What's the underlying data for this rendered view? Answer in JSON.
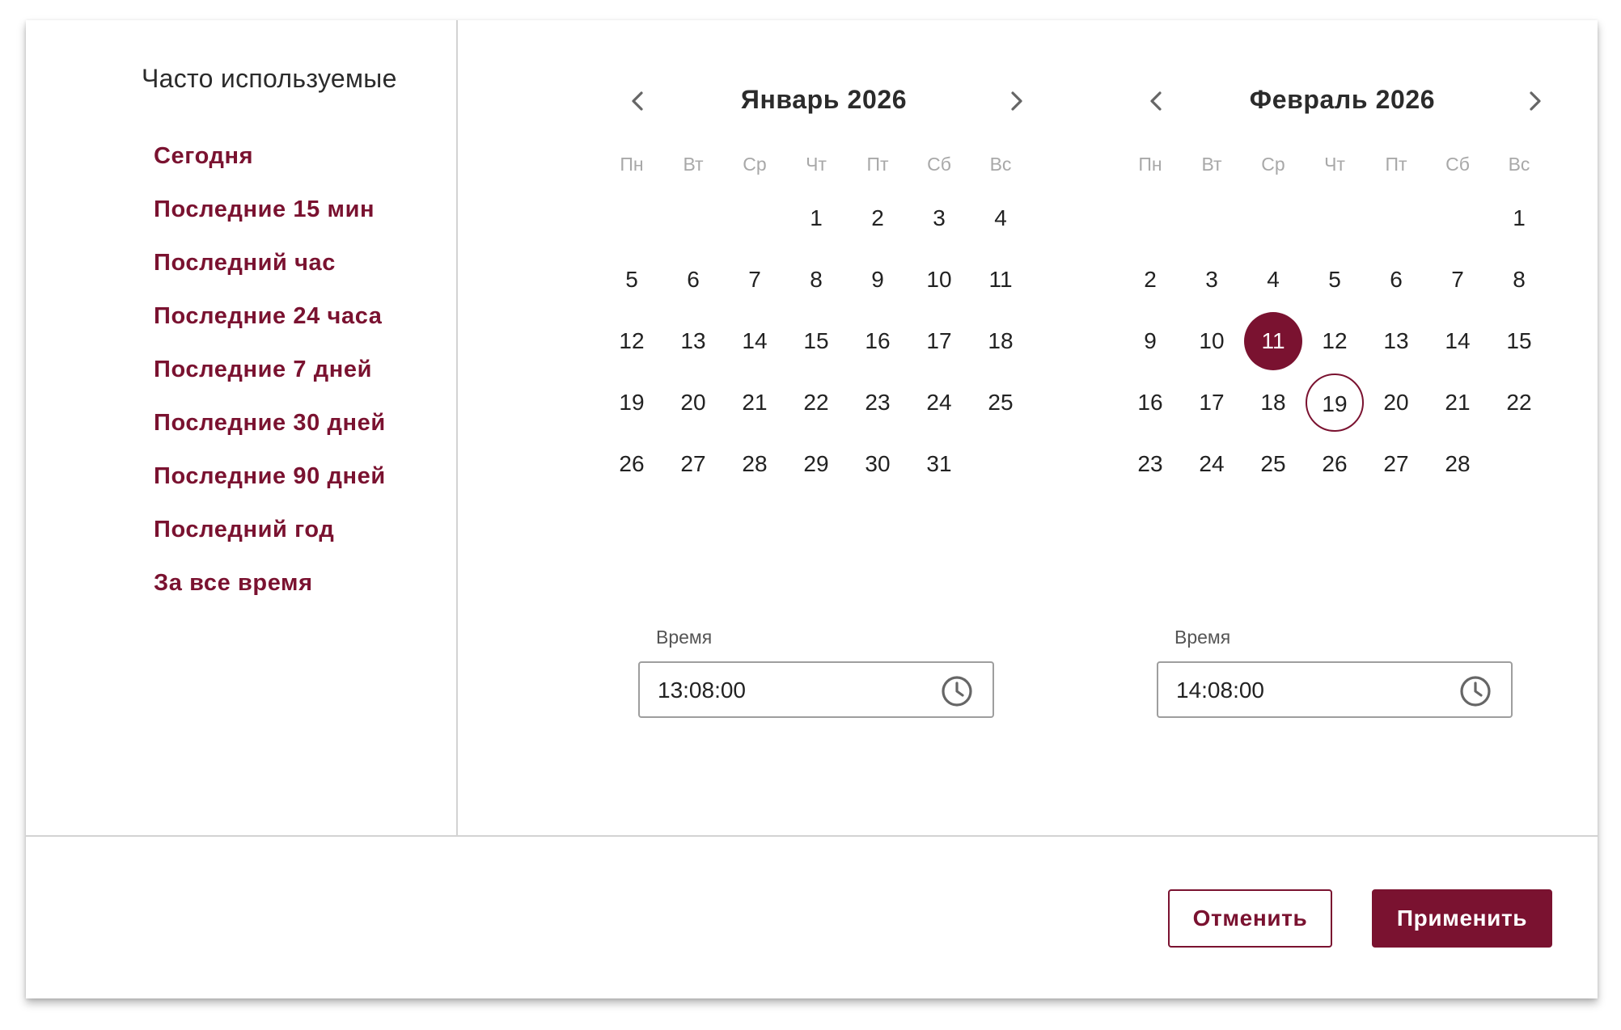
{
  "presets": {
    "title": "Часто используемые",
    "items": [
      {
        "label": "Сегодня"
      },
      {
        "label": "Последние 15 мин"
      },
      {
        "label": "Последний час"
      },
      {
        "label": "Последние 24 часа"
      },
      {
        "label": "Последние 7 дней"
      },
      {
        "label": "Последние 30 дней"
      },
      {
        "label": "Последние 90 дней"
      },
      {
        "label": "Последний год"
      },
      {
        "label": "За все время"
      }
    ]
  },
  "weekdays": [
    "Пн",
    "Вт",
    "Ср",
    "Чт",
    "Пт",
    "Сб",
    "Вс"
  ],
  "calendars": [
    {
      "title": "Январь 2026",
      "first_weekday_index": 3,
      "days_in_month": 31,
      "selected_day": null,
      "today_day": null,
      "time_label": "Время",
      "time_value": "13:08:00"
    },
    {
      "title": "Февраль 2026",
      "first_weekday_index": 6,
      "days_in_month": 28,
      "selected_day": 11,
      "today_day": 19,
      "time_label": "Время",
      "time_value": "14:08:00"
    }
  ],
  "actions": {
    "cancel_label": "Отменить",
    "apply_label": "Применить"
  },
  "colors": {
    "accent": "#7a1230",
    "divider": "#d3d3d3",
    "weekday_text": "#a8a8a8"
  },
  "icons": {
    "prev": "chevron-left-icon",
    "next": "chevron-right-icon",
    "time": "clock-icon"
  }
}
